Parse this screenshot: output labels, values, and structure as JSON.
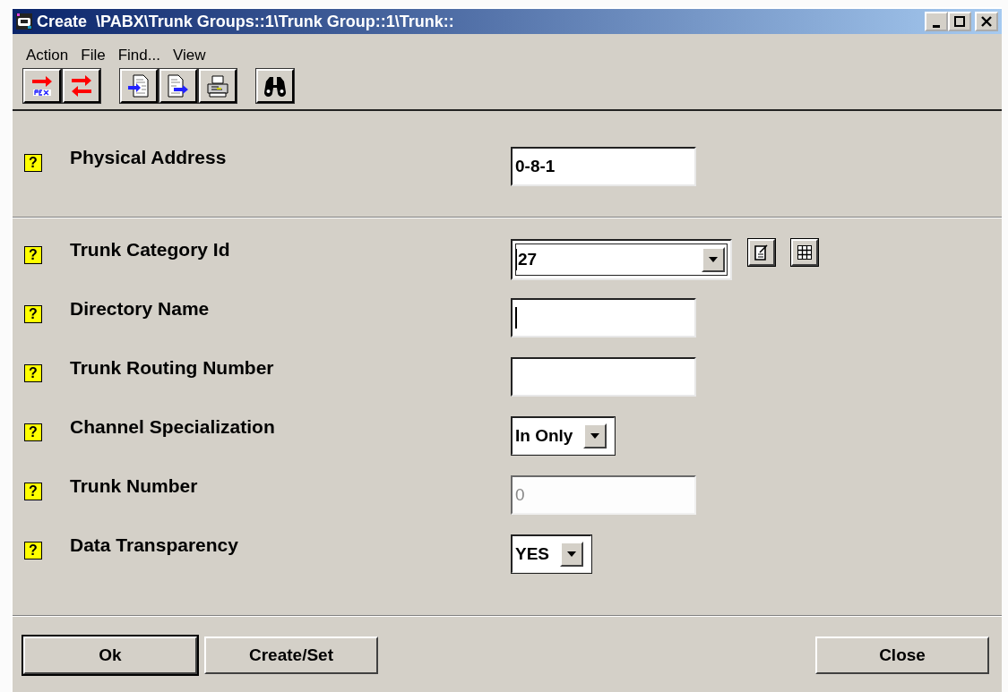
{
  "window": {
    "title": "Create  \\PABX\\Trunk Groups::1\\Trunk Group::1\\Trunk::"
  },
  "menu": [
    "Action",
    "File",
    "Find...",
    "View"
  ],
  "sections": [
    {
      "fields": [
        {
          "help": "?",
          "label": "Physical Address",
          "kind": "text",
          "value": "0-8-1",
          "disabled": false,
          "focused": false
        }
      ]
    },
    {
      "fields": [
        {
          "help": "?",
          "label": "Trunk Category Id",
          "kind": "combo",
          "value": "27",
          "disabled": false,
          "focused": true
        },
        {
          "help": "?",
          "label": "Directory Name",
          "kind": "text",
          "disabled": false,
          "focused": true
        },
        {
          "help": "?",
          "label": "Trunk Routing Number",
          "kind": "text",
          "disabled": false,
          "focused": false
        },
        {
          "help": "?",
          "label": "Channel Specialization",
          "kind": "select",
          "value": "In Only",
          "disabled": false,
          "focused": false
        },
        {
          "help": "?",
          "label": "Trunk Number",
          "kind": "text",
          "value": "0",
          "disabled": true,
          "focused": false
        },
        {
          "help": "?",
          "label": "Data Transparency",
          "kind": "select",
          "value": "YES",
          "disabled": false,
          "focused": false
        }
      ]
    }
  ],
  "buttons": [
    {
      "label": "Ok",
      "default": true
    },
    {
      "label": "Create/Set",
      "default": false
    },
    {
      "label": "Close",
      "default": false
    }
  ]
}
